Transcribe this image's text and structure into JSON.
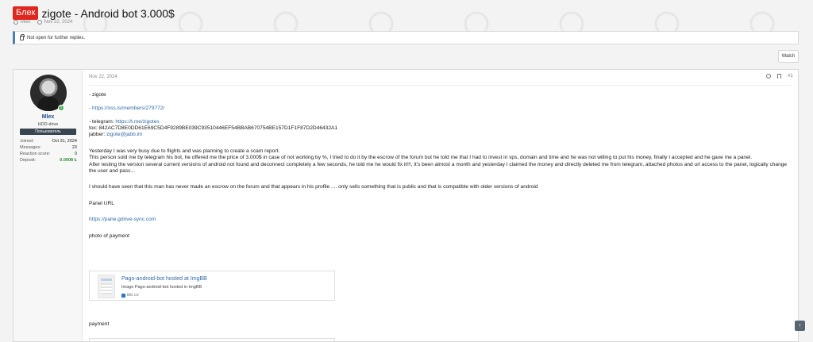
{
  "thread": {
    "prefix": "Блек",
    "title": "zigote - Android bot 3.000$",
    "author": "Mlex",
    "separator": "·",
    "date": "Nov 22, 2024"
  },
  "notice": {
    "text": "Not open for further replies."
  },
  "watch_label": "Watch",
  "user": {
    "name": "Mlex",
    "title": "HDD-drive",
    "banner": "Пользователь",
    "online_badge": "5",
    "stats": [
      {
        "label": "Joined:",
        "value": "Oct 31, 2024"
      },
      {
        "label": "Messages:",
        "value": "23"
      },
      {
        "label": "Reaction score:",
        "value": "0"
      },
      {
        "label": "Deposit:",
        "value": "0.0008 Ł"
      }
    ]
  },
  "post": {
    "date": "Nov 22, 2024",
    "number": "#1",
    "lines": {
      "l1": "- zigote",
      "l2": "- https://xss.is/members/279772/",
      "l3_label": "- telegram: ",
      "l3_link": "https://t.me/zigotes",
      "l4": "tox: 842AC7D8E0DD61E69C5D4F9289BE039C93510446EF54BBAB670754BE157D1F1F87D2D46432A1",
      "l5_label": "jabber: ",
      "l5_link": "zigote@jabb.im",
      "p1": "Yesterday I was very busy due to flights and was planning to create a scam report.",
      "p2": "This person sold me by telegram his bot, he offered me the price of 3.000$ in case of not working by %, I tried to do it by the escrow of the forum but he told me that I had to invest in vps, domain and time and he was not willing to put his money, finally I accepted and he gave me a panel.",
      "p3": "After testing the version several current versions of android not found and deconnect completely a few seconds, he told me he would fix it!!!, it's been almost a month and yesterday I claimed the money and directly deleted me from telegram, attached photos and url access to the panel, logically change the user and pass...",
      "p4": "I should have seen that this man has never made an escrow on the forum and that appears in his profile .... only sells something that is public and that is compatible with older versions of android",
      "panel_label": "Panel URL",
      "panel_url": "https://pane.gdrive-sync.com",
      "photo_label": "photo of payment",
      "payment_label": "payment"
    },
    "embed": {
      "title": "Pago-android-bot hosted at ImgBB",
      "description": "Image Pago-android-bot hosted in ImgBB",
      "domain": "ibb.co"
    }
  },
  "scroll_top_glyph": "↑"
}
